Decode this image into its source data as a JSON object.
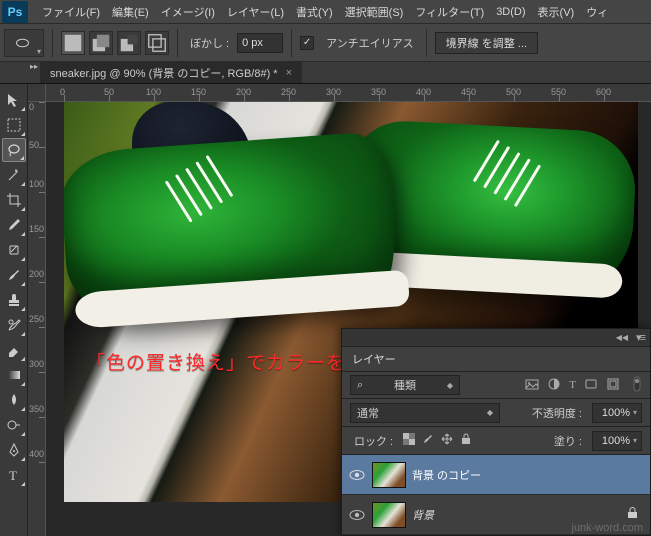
{
  "menu": {
    "items": [
      "ファイル(F)",
      "編集(E)",
      "イメージ(I)",
      "レイヤー(L)",
      "書式(Y)",
      "選択範囲(S)",
      "フィルター(T)",
      "3D(D)",
      "表示(V)",
      "ウィ"
    ]
  },
  "options": {
    "feather_label": "ぼかし :",
    "feather_value": "0 px",
    "antialias_label": "アンチエイリアス",
    "refine_label": "境界線 を調整 ..."
  },
  "document": {
    "tab_title": "sneaker.jpg @ 90% (背景 のコピー, RGB/8#) *"
  },
  "ruler": {
    "h": [
      "0",
      "50",
      "100",
      "150",
      "200",
      "250",
      "300",
      "350",
      "400",
      "450",
      "500",
      "550",
      "600"
    ],
    "v": [
      "0",
      "50",
      "100",
      "150",
      "200",
      "250",
      "300",
      "350",
      "400"
    ]
  },
  "caption": "「色の置き換え」でカラーを変更",
  "layersPanel": {
    "title": "レイヤー",
    "filter_label": "種類",
    "search_value": "",
    "blend_mode": "通常",
    "opacity_label": "不透明度 :",
    "opacity_value": "100%",
    "lock_label": "ロック :",
    "fill_label": "塗り :",
    "fill_value": "100%",
    "layers": [
      {
        "name": "背景 のコピー",
        "selected": true,
        "locked": false,
        "italic": false
      },
      {
        "name": "背景",
        "selected": false,
        "locked": true,
        "italic": true
      }
    ]
  },
  "watermark": "junk-word.com",
  "icons": {
    "search": "⌕"
  }
}
